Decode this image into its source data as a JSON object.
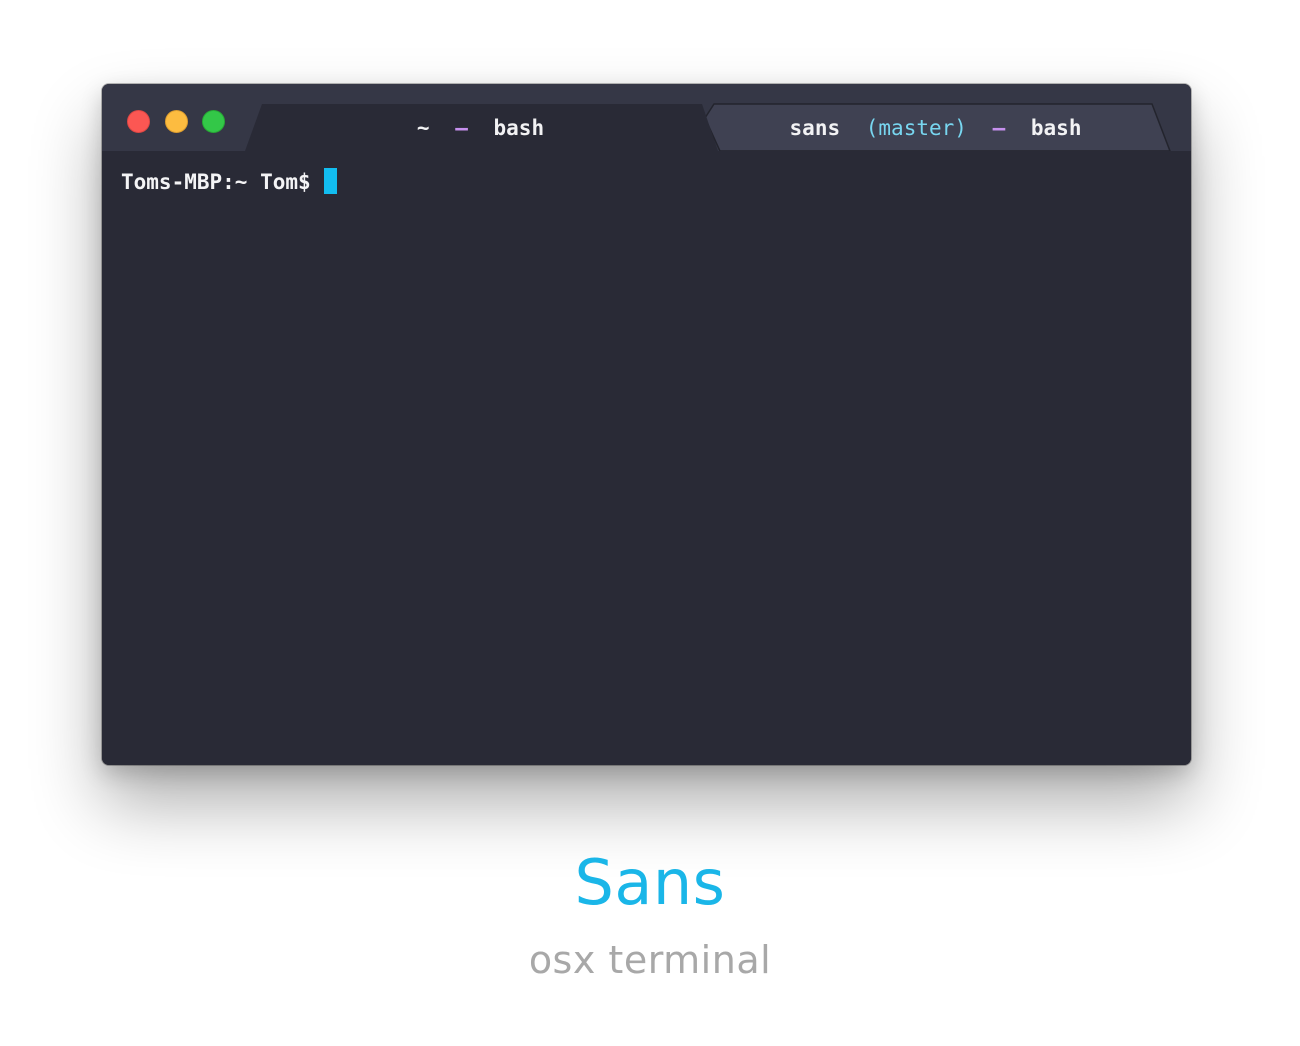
{
  "window": {
    "traffic_lights": {
      "close": "close-button",
      "minimize": "minimize-button",
      "maximize": "maximize-button"
    },
    "tabs": [
      {
        "label_prefix": "~",
        "separator": "–",
        "label_suffix": "bash",
        "active": true
      },
      {
        "label_prefix": "sans",
        "branch": "(master)",
        "separator": "–",
        "label_suffix": "bash",
        "active": false
      }
    ]
  },
  "terminal": {
    "prompt": "Toms-MBP:~ Tom$"
  },
  "caption": {
    "title": "Sans",
    "subtitle": "osx terminal"
  },
  "colors": {
    "terminal_background": "#292a36",
    "titlebar_background": "#353746",
    "inactive_tab": "#3f4152",
    "separator": "#c690ee",
    "branch": "#78d6f0",
    "cursor": "#12bdf0",
    "caption_title": "#1ab6e8",
    "caption_subtitle": "#a8a8a8"
  }
}
